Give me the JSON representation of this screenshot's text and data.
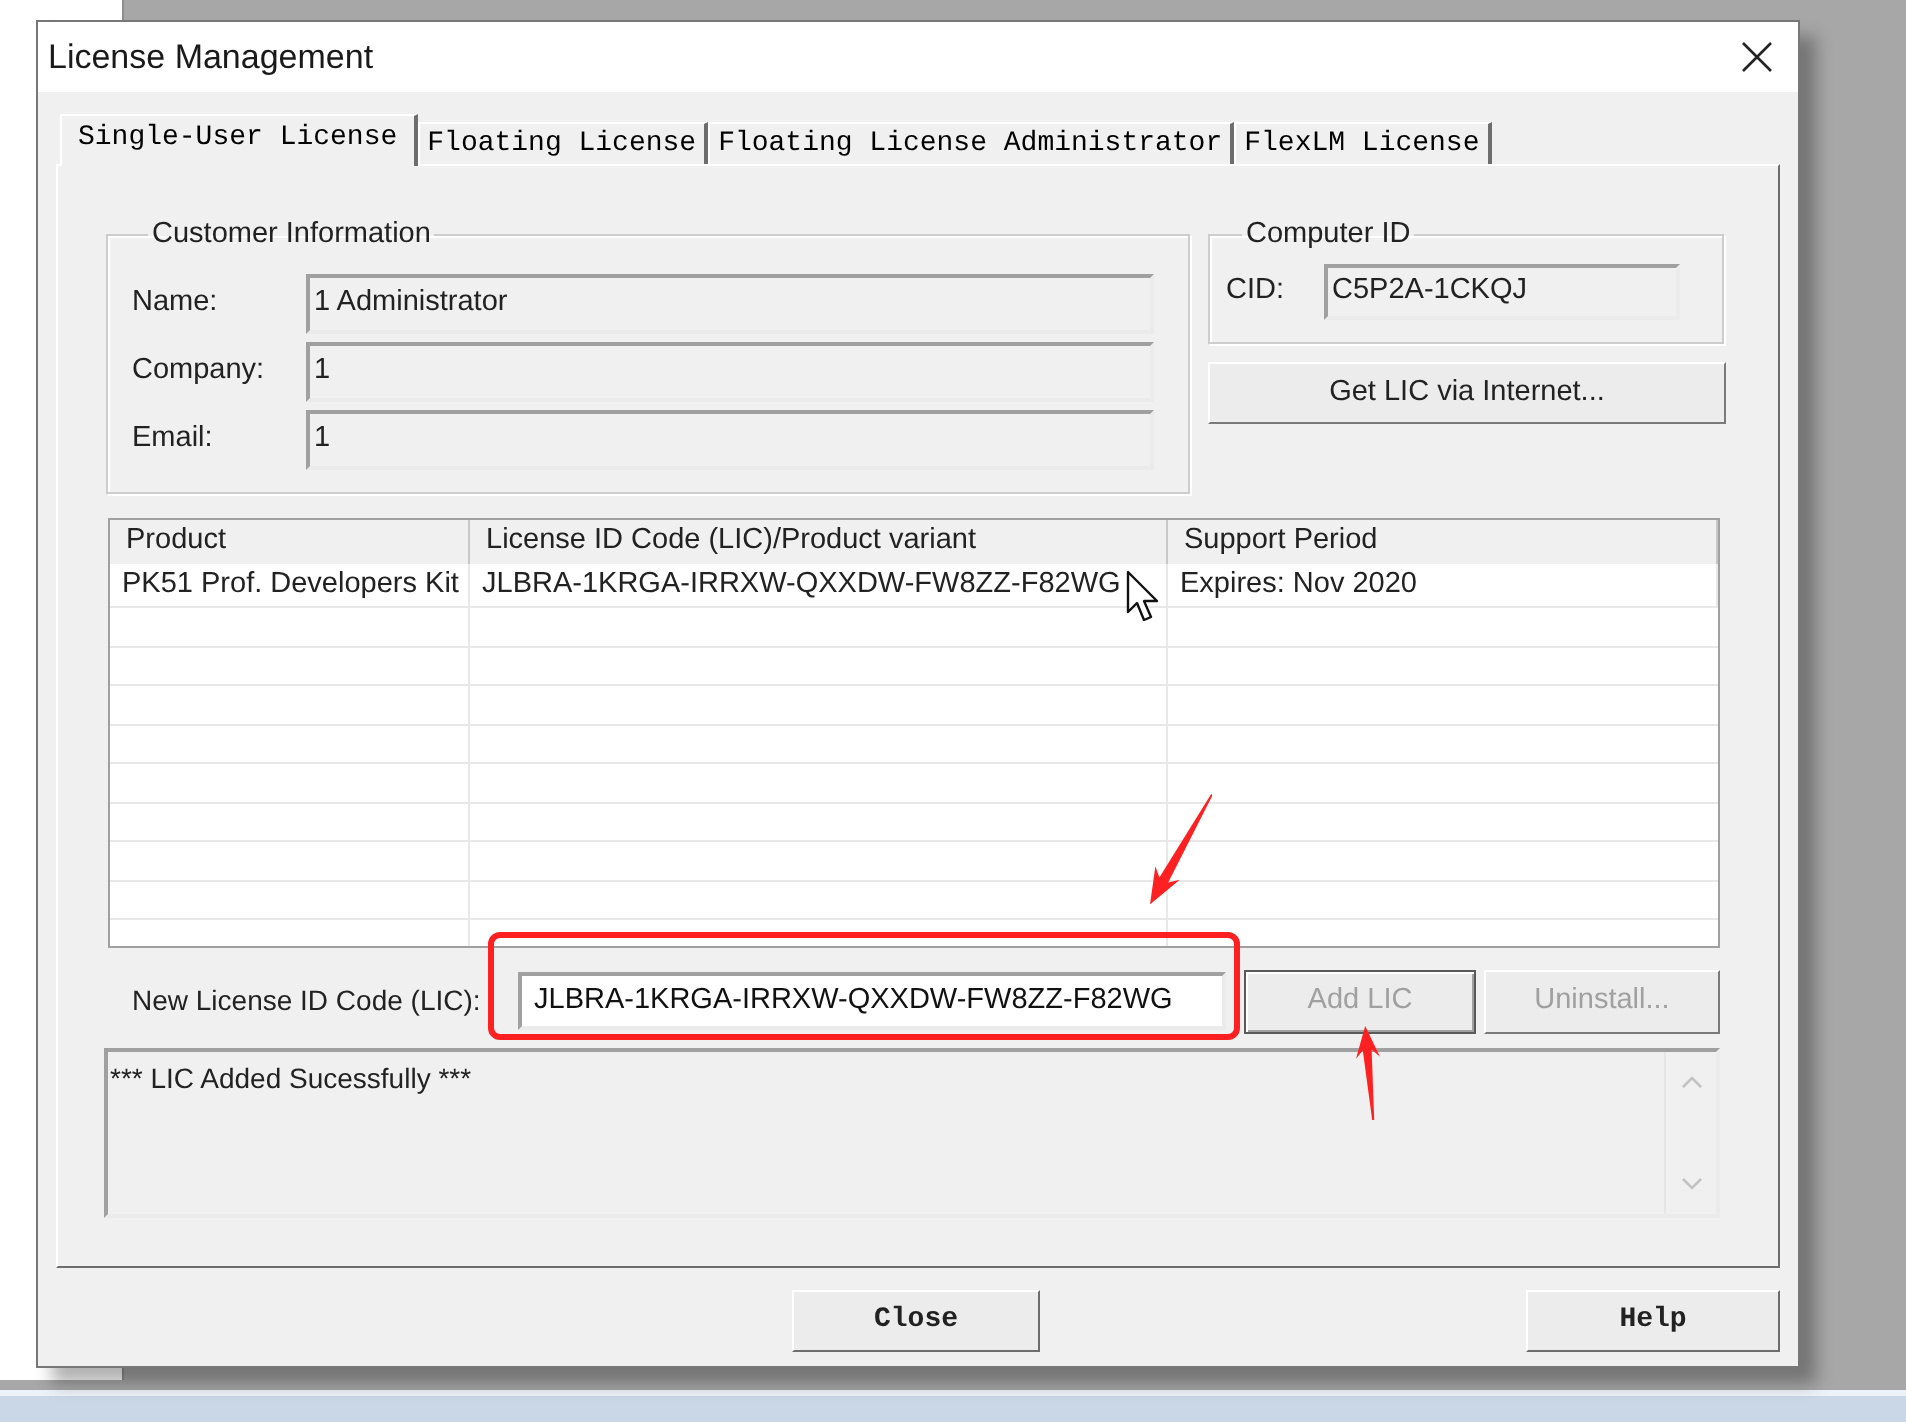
{
  "window": {
    "title": "License Management"
  },
  "tabs": [
    {
      "label": "Single-User License",
      "selected": true
    },
    {
      "label": "Floating License",
      "selected": false
    },
    {
      "label": "Floating License Administrator",
      "selected": false
    },
    {
      "label": "FlexLM License",
      "selected": false
    }
  ],
  "customer_information": {
    "title": "Customer Information",
    "fields": [
      {
        "label": "Name:",
        "value": "1 Administrator"
      },
      {
        "label": "Company:",
        "value": "1"
      },
      {
        "label": "Email:",
        "value": "1"
      }
    ]
  },
  "computer_id": {
    "title": "Computer ID",
    "label": "CID:",
    "value": "C5P2A-1CKQJ"
  },
  "get_lic_button": "Get LIC via Internet...",
  "license_table": {
    "columns": [
      "Product",
      "License ID Code (LIC)/Product variant",
      "Support Period"
    ],
    "rows": [
      [
        "PK51 Prof. Developers Kit",
        "JLBRA-1KRGA-IRRXW-QXXDW-FW8ZZ-F82WG",
        "Expires: Nov 2020"
      ]
    ]
  },
  "new_license": {
    "label": "New License ID Code (LIC):",
    "value": "JLBRA-1KRGA-IRRXW-QXXDW-FW8ZZ-F82WG"
  },
  "actions": [
    {
      "label": "Add LIC",
      "disabled": true,
      "default": true
    },
    {
      "label": "Uninstall...",
      "disabled": true,
      "default": false
    }
  ],
  "log": {
    "lines": [
      "*** LIC Added Sucessfully ***"
    ]
  },
  "footer_buttons": [
    "Close",
    "Help"
  ]
}
